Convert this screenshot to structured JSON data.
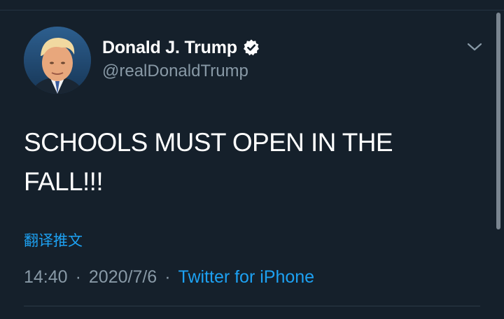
{
  "tweet": {
    "display_name": "Donald J. Trump",
    "handle": "@realDonaldTrump",
    "text": "SCHOOLS MUST OPEN IN THE\nFALL!!!",
    "translate_label": "翻译推文",
    "time": "14:40",
    "separator": "·",
    "date": "2020/7/6",
    "source": "Twitter for iPhone"
  },
  "icons": {
    "verified": "verified-badge-icon",
    "caret": "chevron-down-icon"
  },
  "colors": {
    "background": "#15202b",
    "text_primary": "#ffffff",
    "text_secondary": "#8899a6",
    "accent": "#1da1f2"
  }
}
